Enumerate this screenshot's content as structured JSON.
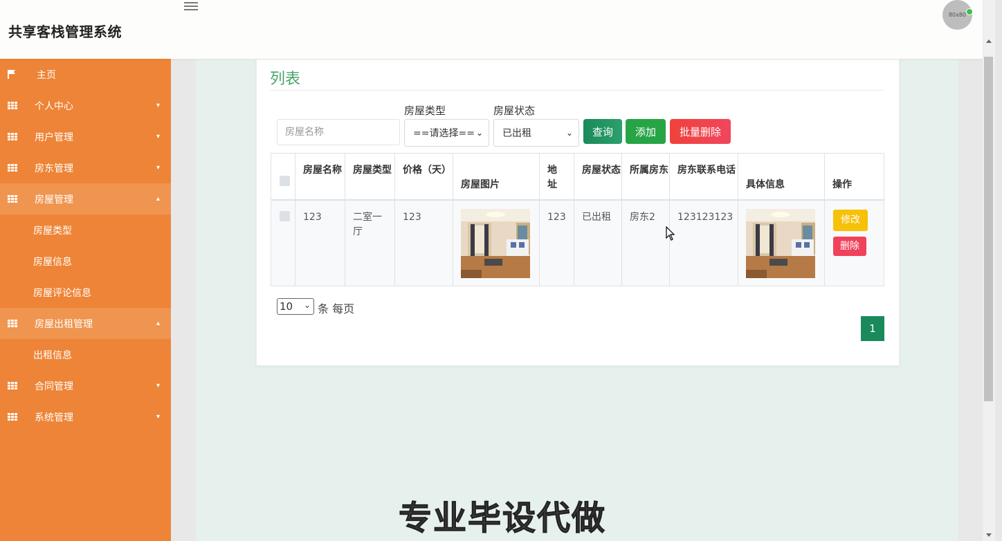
{
  "app": {
    "title": "共享客栈管理系统",
    "avatar_text": "80x80",
    "colors": {
      "sidebar": "#ed8437",
      "sidebar_active": "#ef9550",
      "title_accent": "#4aa36a",
      "content_bg": "#e6f0ec"
    }
  },
  "sidebar": {
    "home": "主页",
    "items": [
      {
        "label": "个人中心",
        "icon": "grid-icon"
      },
      {
        "label": "用户管理",
        "icon": "grid-icon"
      },
      {
        "label": "房东管理",
        "icon": "grid-icon"
      },
      {
        "label": "房屋管理",
        "icon": "grid-icon",
        "expanded": true,
        "children": [
          "房屋类型",
          "房屋信息",
          "房屋评论信息"
        ]
      },
      {
        "label": "房屋出租管理",
        "icon": "grid-icon",
        "expanded": true,
        "children": [
          "出租信息"
        ]
      },
      {
        "label": "合同管理",
        "icon": "grid-icon"
      },
      {
        "label": "系统管理",
        "icon": "grid-icon"
      }
    ]
  },
  "main": {
    "title": "列表",
    "search": {
      "name_placeholder": "房屋名称",
      "type_label": "房屋类型",
      "type_value": "==请选择==",
      "status_label": "房屋状态",
      "status_value": "已出租"
    },
    "buttons": {
      "query": "查询",
      "add": "添加",
      "batch_delete": "批量删除"
    },
    "table": {
      "headers": [
        "房屋名称",
        "房屋类型",
        "价格（天）",
        "房屋图片",
        "地址",
        "房屋状态",
        "所属房东",
        "房东联系电话",
        "具体信息",
        "操作"
      ],
      "rows": [
        {
          "name": "123",
          "type": "二室一厅",
          "price": "123",
          "image": "living-room-photo",
          "address": "123",
          "status": "已出租",
          "landlord": "房东2",
          "phone": "123123123",
          "detail_image": "living-room-photo",
          "edit": "修改",
          "delete": "删除"
        }
      ]
    },
    "pagination": {
      "per_page": "10",
      "per_page_suffix": "条 每页",
      "current_page": "1"
    }
  },
  "watermark": "专业毕设代做"
}
